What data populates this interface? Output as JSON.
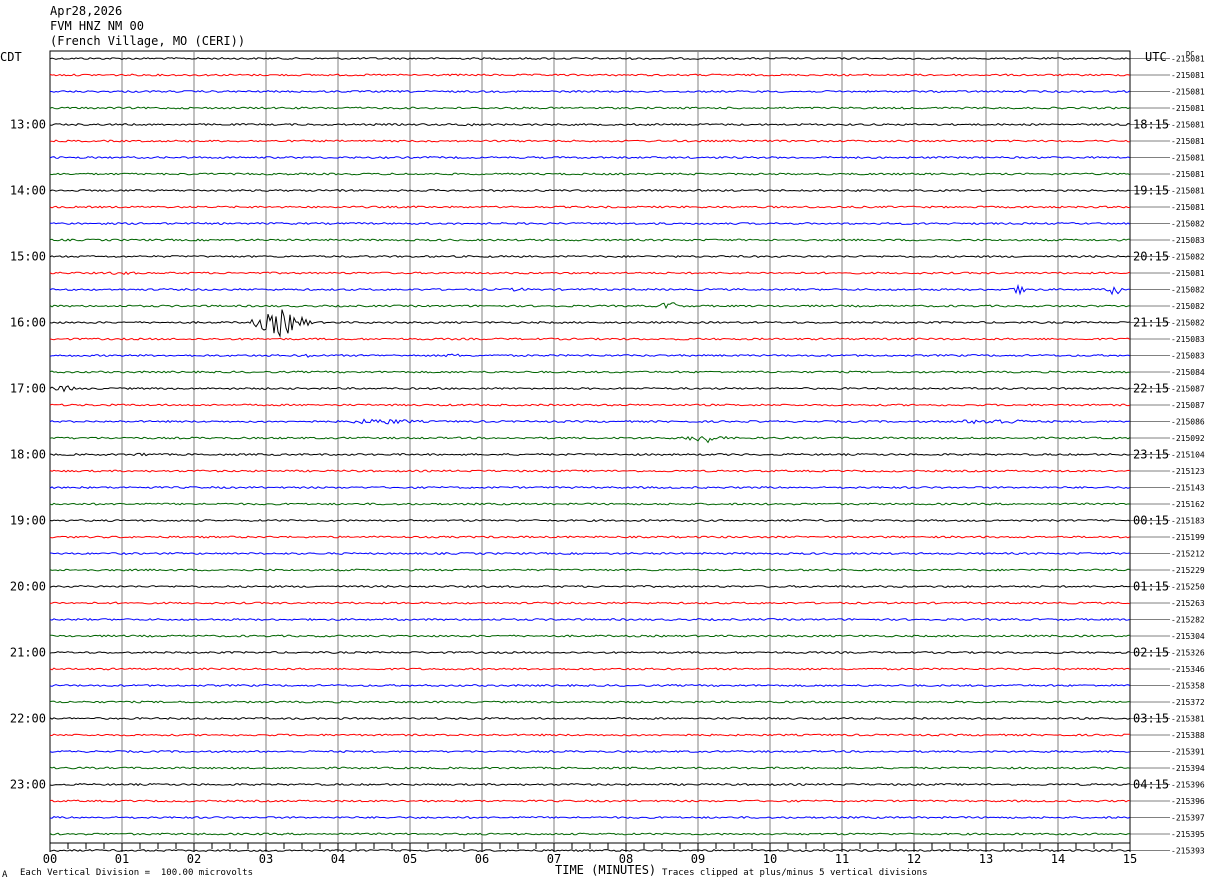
{
  "header": {
    "date": "Apr28,2026",
    "station": "FVM HNZ NM 00",
    "location": "(French Village, MO (CERI))"
  },
  "left_tz": "CDT",
  "right_tz": "UTC",
  "dc_label": "DC",
  "footer": {
    "scale_note": "Each Vertical Division =  100.00 microvolts",
    "xlabel": "TIME (MINUTES)",
    "clip_note": "Traces clipped at plus/minus 5 vertical divisions",
    "corner_mark": "A"
  },
  "colors": {
    "trace_cycle": [
      "#000000",
      "#ff0000",
      "#0000ff",
      "#006400"
    ],
    "grid": "#808080"
  },
  "chart_data": {
    "type": "line",
    "title": "",
    "xlabel": "TIME (MINUTES)",
    "xlim": [
      0,
      15
    ],
    "x_ticks": [
      "00",
      "01",
      "02",
      "03",
      "04",
      "05",
      "06",
      "07",
      "08",
      "09",
      "10",
      "11",
      "12",
      "13",
      "14",
      "15"
    ],
    "left_hour_labels": [
      "13:00",
      "14:00",
      "15:00",
      "16:00",
      "17:00",
      "18:00",
      "19:00",
      "20:00",
      "21:00",
      "22:00",
      "23:00"
    ],
    "right_hour_labels": [
      "18:15",
      "19:15",
      "20:15",
      "21:15",
      "22:15",
      "23:15",
      "00:15",
      "01:15",
      "02:15",
      "03:15",
      "04:15"
    ],
    "trace_dc_offsets": [
      "-215081",
      "-215081",
      "-215081",
      "-215081",
      "-215081",
      "-215081",
      "-215081",
      "-215081",
      "-215081",
      "-215081",
      "-215082",
      "-215083",
      "-215082",
      "-215081",
      "-215082",
      "-215082",
      "-215082",
      "-215083",
      "-215083",
      "-215084",
      "-215087",
      "-215087",
      "-215086",
      "-215092",
      "-215104",
      "-215123",
      "-215143",
      "-215162",
      "-215183",
      "-215199",
      "-215212",
      "-215229",
      "-215250",
      "-215263",
      "-215282",
      "-215304",
      "-215326",
      "-215346",
      "-215358",
      "-215372",
      "-215381",
      "-215388",
      "-215391",
      "-215394",
      "-215396",
      "-215396",
      "-215397",
      "-215395",
      "-215393"
    ],
    "events": [
      {
        "trace": 4,
        "minute": 5.8,
        "amplitude": 2,
        "width": 0.35
      },
      {
        "trace": 8,
        "minute": 4.0,
        "amplitude": 1.5,
        "width": 0.3
      },
      {
        "trace": 12,
        "minute": 0.2,
        "amplitude": 1,
        "width": 0.3
      },
      {
        "trace": 13,
        "minute": 1.0,
        "amplitude": 2,
        "width": 0.4
      },
      {
        "trace": 14,
        "minute": 6.5,
        "amplitude": 2,
        "width": 0.3
      },
      {
        "trace": 14,
        "minute": 13.5,
        "amplitude": 5,
        "width": 0.25
      },
      {
        "trace": 14,
        "minute": 14.8,
        "amplitude": 7,
        "width": 0.15
      },
      {
        "trace": 15,
        "minute": 8.6,
        "amplitude": 7,
        "width": 0.15
      },
      {
        "trace": 16,
        "minute": 3.2,
        "amplitude": 14,
        "width": 0.5
      },
      {
        "trace": 18,
        "minute": 3.6,
        "amplitude": 2,
        "width": 0.3
      },
      {
        "trace": 18,
        "minute": 5.6,
        "amplitude": 2,
        "width": 0.3
      },
      {
        "trace": 20,
        "minute": 0.2,
        "amplitude": 3,
        "width": 0.4
      },
      {
        "trace": 22,
        "minute": 4.6,
        "amplitude": 3,
        "width": 0.9
      },
      {
        "trace": 22,
        "minute": 13.1,
        "amplitude": 3,
        "width": 0.9
      },
      {
        "trace": 23,
        "minute": 9.1,
        "amplitude": 5,
        "width": 0.4
      },
      {
        "trace": 24,
        "minute": 1.3,
        "amplitude": 2,
        "width": 0.3
      }
    ]
  }
}
